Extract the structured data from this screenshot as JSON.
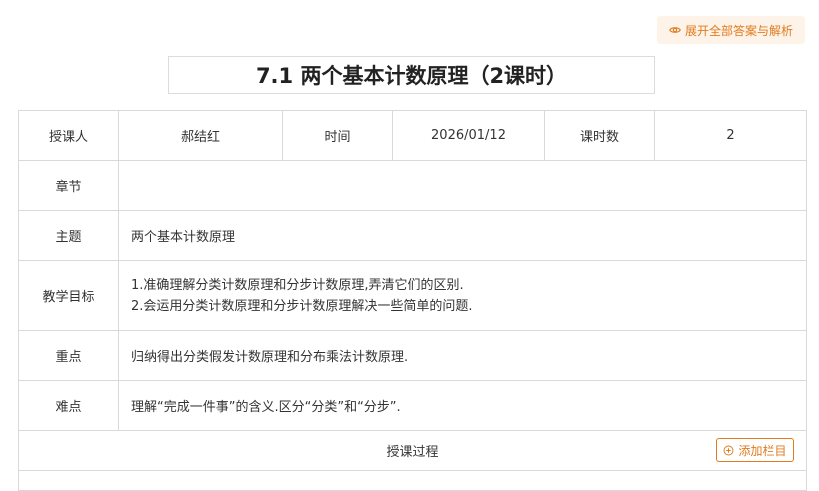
{
  "expand_button": {
    "label": "展开全部答案与解析",
    "icon": "eye-icon"
  },
  "title": "7.1 两个基本计数原理（2课时）",
  "info_row": {
    "teacher_label": "授课人",
    "teacher_value": "郝结红",
    "time_label": "时间",
    "time_value": "2026/01/12",
    "hours_label": "课时数",
    "hours_value": "2"
  },
  "rows": {
    "chapter": {
      "label": "章节",
      "value": ""
    },
    "topic": {
      "label": "主题",
      "value": "两个基本计数原理"
    },
    "goals": {
      "label": "教学目标",
      "lines": [
        "1.准确理解分类计数原理和分步计数原理,弄清它们的区别.",
        "2.会运用分类计数原理和分步计数原理解决一些简单的问题."
      ]
    },
    "key_points": {
      "label": "重点",
      "value": "归纳得出分类假发计数原理和分布乘法计数原理."
    },
    "difficulties": {
      "label": "难点",
      "value": "理解“完成一件事”的含义.区分“分类”和“分步”."
    }
  },
  "process": {
    "label": "授课过程",
    "add_button": "添加栏目",
    "add_icon": "plus-circle-icon"
  },
  "colors": {
    "accent": "#e07b1f",
    "accent_bg": "#fdf3e8",
    "border": "#d9d9d9"
  }
}
